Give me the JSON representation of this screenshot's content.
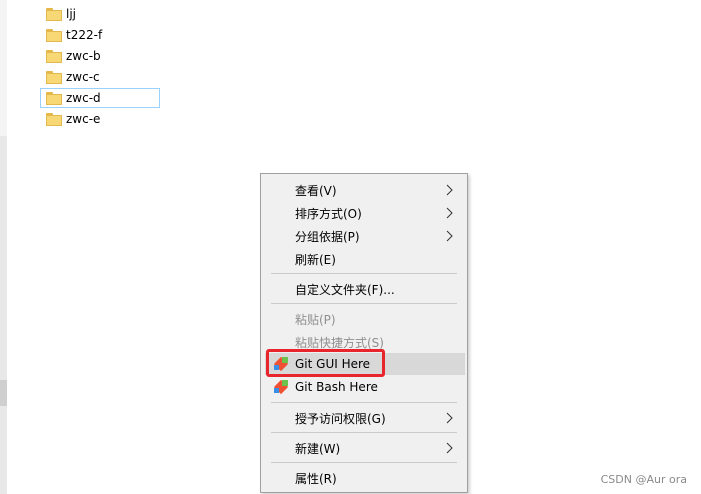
{
  "files": [
    {
      "name": "ljj",
      "icon": "folder-icon"
    },
    {
      "name": "t222-f",
      "icon": "folder-icon"
    },
    {
      "name": "zwc-b",
      "icon": "folder-icon"
    },
    {
      "name": "zwc-c",
      "icon": "folder-icon"
    },
    {
      "name": "zwc-d",
      "icon": "folder-icon",
      "focused": true
    },
    {
      "name": "zwc-e",
      "icon": "folder-icon"
    }
  ],
  "context_menu": {
    "view": "查看(V)",
    "sort_by": "排序方式(O)",
    "group_by": "分组依据(P)",
    "refresh": "刷新(E)",
    "customize_folder": "自定义文件夹(F)...",
    "paste": "粘贴(P)",
    "paste_shortcut": "粘贴快捷方式(S)",
    "git_gui": "Git GUI Here",
    "git_bash": "Git Bash Here",
    "give_access": "授予访问权限(G)",
    "new": "新建(W)",
    "properties": "属性(R)"
  },
  "colors": {
    "highlight_box": "#e8242c",
    "menu_background": "#f0f0f0",
    "menu_hover": "#d8d8d8",
    "folder": "#f8d775"
  },
  "watermark": "CSDN @Aur ora"
}
